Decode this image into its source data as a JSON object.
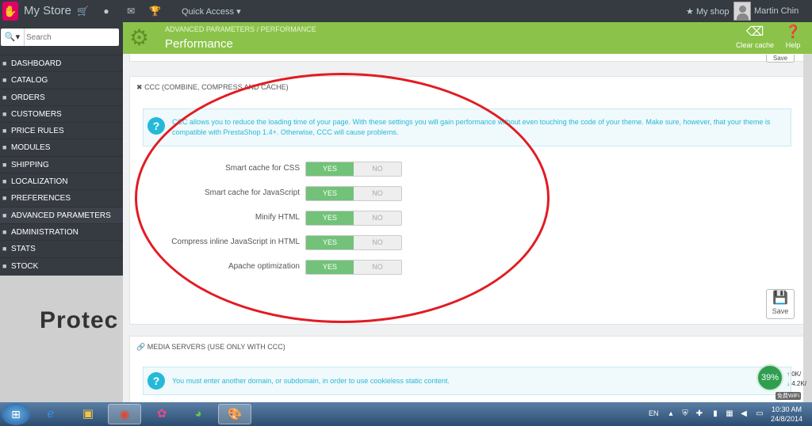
{
  "topbar": {
    "store_name": "My Store",
    "quick_access": "Quick Access ▾",
    "my_shop": "My shop",
    "user_name": "Martin Chin"
  },
  "search": {
    "placeholder": "Search"
  },
  "menu": [
    {
      "label": "DASHBOARD",
      "icon": "dashboard-icon"
    },
    {
      "label": "CATALOG",
      "icon": "catalog-icon"
    },
    {
      "label": "ORDERS",
      "icon": "orders-icon"
    },
    {
      "label": "CUSTOMERS",
      "icon": "customers-icon"
    },
    {
      "label": "PRICE RULES",
      "icon": "price-rules-icon"
    },
    {
      "label": "MODULES",
      "icon": "modules-icon"
    },
    {
      "label": "SHIPPING",
      "icon": "shipping-icon"
    },
    {
      "label": "LOCALIZATION",
      "icon": "localization-icon"
    },
    {
      "label": "PREFERENCES",
      "icon": "preferences-icon"
    },
    {
      "label": "ADVANCED PARAMETERS",
      "icon": "advanced-parameters-icon",
      "active": true
    },
    {
      "label": "ADMINISTRATION",
      "icon": "administration-icon"
    },
    {
      "label": "STATS",
      "icon": "stats-icon"
    },
    {
      "label": "STOCK",
      "icon": "stock-icon"
    }
  ],
  "sidebar_bottom_text": "Protec",
  "header": {
    "breadcrumb": "ADVANCED PARAMETERS  /  PERFORMANCE",
    "title": "Performance",
    "clear_cache": "Clear cache",
    "help": "Help"
  },
  "top_panel": {
    "save": "Save"
  },
  "ccc_panel": {
    "heading": "CCC (COMBINE, COMPRESS AND CACHE)",
    "alert": "CCC allows you to reduce the loading time of your page. With these settings you will gain performance without even touching the code of your theme. Make sure, however, that your theme is compatible with PrestaShop 1.4+. Otherwise, CCC will cause problems.",
    "rows": [
      {
        "label": "Smart cache for CSS",
        "yes": "YES",
        "no": "NO"
      },
      {
        "label": "Smart cache for JavaScript",
        "yes": "YES",
        "no": "NO"
      },
      {
        "label": "Minify HTML",
        "yes": "YES",
        "no": "NO"
      },
      {
        "label": "Compress inline JavaScript in HTML",
        "yes": "YES",
        "no": "NO"
      },
      {
        "label": "Apache optimization",
        "yes": "YES",
        "no": "NO"
      }
    ],
    "save": "Save"
  },
  "media_panel": {
    "heading": "MEDIA SERVERS (USE ONLY WITH CCC)",
    "alert": "You must enter another domain, or subdomain, in order to use cookieless static content."
  },
  "net_widget": {
    "percent": "39%",
    "up": "0K/",
    "down": "4.2K/",
    "wifi": "免费WiFi"
  },
  "taskbar": {
    "lang": "EN",
    "time": "10:30 AM",
    "date": "24/8/2014"
  }
}
